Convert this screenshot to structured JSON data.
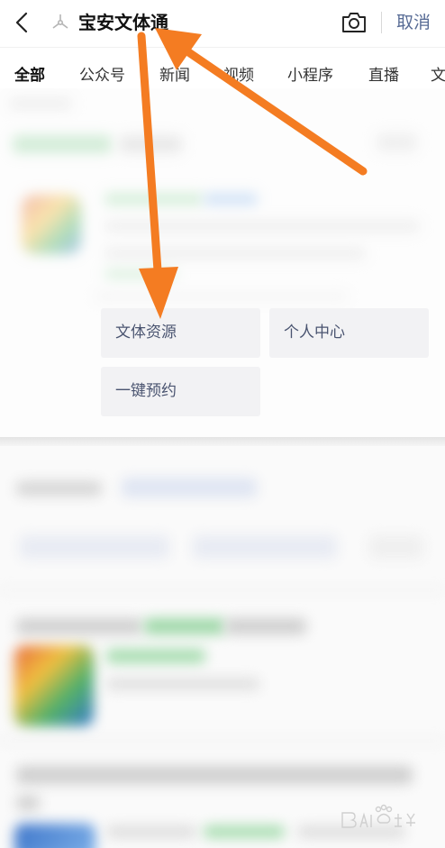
{
  "header": {
    "query": "宝安文体通",
    "cancel_label": "取消"
  },
  "tabs": [
    {
      "label": "全部",
      "active": true
    },
    {
      "label": "公众号"
    },
    {
      "label": "新闻"
    },
    {
      "label": "视频"
    },
    {
      "label": "小程序"
    },
    {
      "label": "直播"
    },
    {
      "label": "文"
    }
  ],
  "services": [
    {
      "label": "文体资源"
    },
    {
      "label": "个人中心"
    },
    {
      "label": "一键预约"
    }
  ],
  "colors": {
    "accent_link": "#576b95",
    "annotation_arrow": "#f47c22",
    "service_bg": "#f2f2f4"
  },
  "icons": [
    "back-arrow-icon",
    "mini-program-icon",
    "camera-icon"
  ],
  "watermark": {
    "text": "Baidu 经验"
  }
}
